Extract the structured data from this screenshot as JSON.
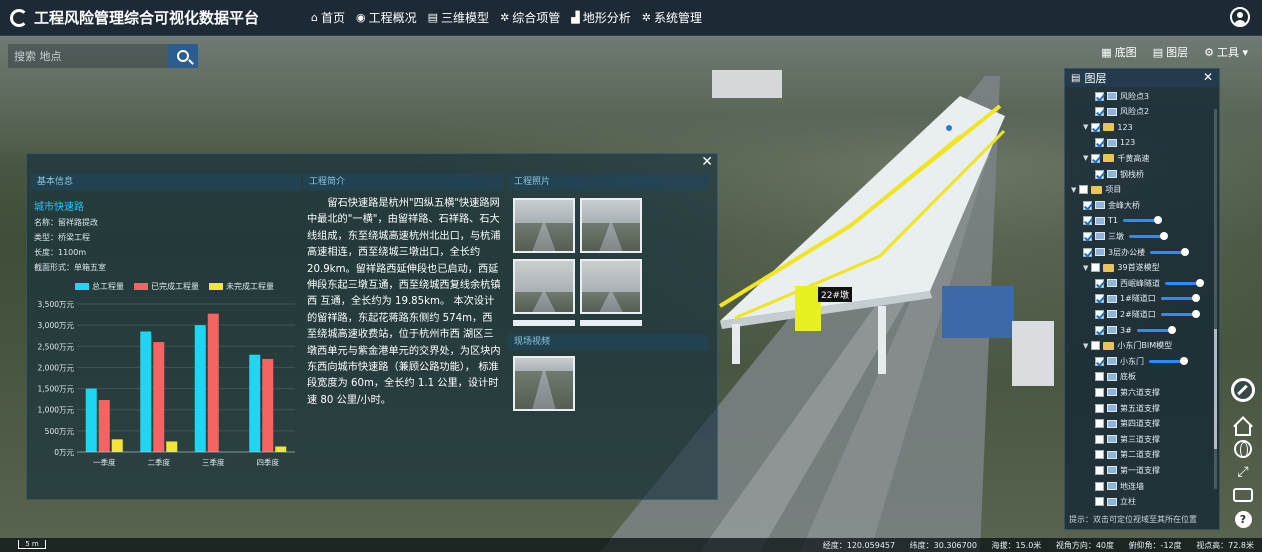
{
  "app": {
    "title": "工程风险管理综合可视化数据平台"
  },
  "nav": [
    {
      "label": "首页",
      "icon": "home-icon"
    },
    {
      "label": "工程概况",
      "icon": "eye-icon"
    },
    {
      "label": "三维模型",
      "icon": "layers-icon"
    },
    {
      "label": "综合项管",
      "icon": "gear-icon"
    },
    {
      "label": "地形分析",
      "icon": "chart-icon"
    },
    {
      "label": "系统管理",
      "icon": "gear-icon"
    }
  ],
  "search": {
    "placeholder": "搜索 地点"
  },
  "toolbar": [
    {
      "label": "底图",
      "icon": "map-icon"
    },
    {
      "label": "图层",
      "icon": "layers-icon"
    },
    {
      "label": "工具 ▾",
      "icon": "tools-icon"
    }
  ],
  "info": {
    "basic": {
      "head": "基本信息",
      "name_link": "城市快速路",
      "name": "名称：留祥路提改",
      "type": "类型：桥梁工程",
      "length": "长度：1100m",
      "section": "截面形式：单箱五室"
    },
    "intro": {
      "head": "工程简介",
      "text": "留石快速路是杭州\"四纵五横\"快速路网中最北的\"一横\"，由留祥路、石祥路、石大线组成，东至绕城高速杭州北出口，与杭浦高速相连，西至绕城三墩出口，全长约 20.9km。留祥路西延伸段也已启动，西延伸段东起三墩互通，西至绕城西复线余杭镇西 互通，全长约为 19.85km。 本次设计的留祥路，东起花蒋路东侧约 574m，西至绕城高速收费站，位于杭州市西 湖区三墩西单元与紫金港单元的交界处，为区块内东西向城市快速路（兼顾公路功能）， 标准段宽度为 60m，全长约 1.1 公里，设计时速 80 公里/小时。"
    },
    "photos": {
      "head": "工程照片"
    },
    "video": {
      "head": "现场视频"
    }
  },
  "chart_data": {
    "type": "bar",
    "categories": [
      "一季度",
      "二季度",
      "三季度",
      "四季度"
    ],
    "series": [
      {
        "name": "总工程量",
        "values": [
          1500,
          2850,
          3000,
          2300
        ],
        "color": "#1fd6f2"
      },
      {
        "name": "已完成工程量",
        "values": [
          1230,
          2600,
          3270,
          2200
        ],
        "color": "#f56363"
      },
      {
        "name": "未完成工程量",
        "values": [
          300,
          250,
          0,
          130
        ],
        "color": "#f4e43a"
      }
    ],
    "yticks": [
      "0万元",
      "500万元",
      "1,000万元",
      "1,500万元",
      "2,000万元",
      "2,500万元",
      "3,000万元",
      "3,500万元"
    ],
    "ylim": [
      0,
      3500
    ],
    "legend_position": "top"
  },
  "layers": {
    "title": "图层",
    "rows": [
      {
        "label": "风险点3",
        "level": 2,
        "kind": "layer",
        "checked": true
      },
      {
        "label": "风险点2",
        "level": 2,
        "kind": "layer",
        "checked": true
      },
      {
        "label": "123",
        "level": 1,
        "kind": "folder",
        "checked": true
      },
      {
        "label": "123",
        "level": 2,
        "kind": "layer",
        "checked": true
      },
      {
        "label": "千黄高速",
        "level": 1,
        "kind": "folder",
        "checked": true
      },
      {
        "label": "钢栈桥",
        "level": 2,
        "kind": "layer",
        "checked": true
      },
      {
        "label": "项目",
        "level": 0,
        "kind": "folder",
        "checked": false
      },
      {
        "label": "金峰大桥",
        "level": 1,
        "kind": "layer",
        "checked": true
      },
      {
        "label": "T1",
        "level": 1,
        "kind": "layer",
        "checked": true,
        "slider": true
      },
      {
        "label": "三墩",
        "level": 1,
        "kind": "layer",
        "checked": true,
        "slider": true
      },
      {
        "label": "3层办公楼",
        "level": 1,
        "kind": "layer",
        "checked": true,
        "slider": true
      },
      {
        "label": "39首遂模型",
        "level": 1,
        "kind": "folder",
        "checked": false
      },
      {
        "label": "西岷峰隧道",
        "level": 2,
        "kind": "layer",
        "checked": true,
        "slider": true
      },
      {
        "label": "1#隧道口",
        "level": 2,
        "kind": "layer",
        "checked": true,
        "slider": true
      },
      {
        "label": "2#隧道口",
        "level": 2,
        "kind": "layer",
        "checked": true,
        "slider": true
      },
      {
        "label": "3#",
        "level": 2,
        "kind": "layer",
        "checked": true,
        "slider": true
      },
      {
        "label": "小东门BIM模型",
        "level": 1,
        "kind": "folder",
        "checked": false
      },
      {
        "label": "小东门",
        "level": 2,
        "kind": "layer",
        "checked": true,
        "slider": true
      },
      {
        "label": "底板",
        "level": 2,
        "kind": "layer",
        "checked": false
      },
      {
        "label": "第六道支撑",
        "level": 2,
        "kind": "layer",
        "checked": false
      },
      {
        "label": "第五道支撑",
        "level": 2,
        "kind": "layer",
        "checked": false
      },
      {
        "label": "第四道支撑",
        "level": 2,
        "kind": "layer",
        "checked": false
      },
      {
        "label": "第三道支撑",
        "level": 2,
        "kind": "layer",
        "checked": false
      },
      {
        "label": "第二道支撑",
        "level": 2,
        "kind": "layer",
        "checked": false
      },
      {
        "label": "第一道支撑",
        "level": 2,
        "kind": "layer",
        "checked": false
      },
      {
        "label": "地连墙",
        "level": 2,
        "kind": "layer",
        "checked": false
      },
      {
        "label": "立柱",
        "level": 2,
        "kind": "layer",
        "checked": false
      }
    ],
    "hint": "提示：双击可定位视域至其所在位置"
  },
  "model_tag": "22#墩",
  "status": {
    "scale": "5 m",
    "lon": "经度：120.059457",
    "lat": "纬度：30.306700",
    "alt": "海拔：15.0米",
    "heading": "视角方向：40度",
    "pitch": "俯仰角：-12度",
    "height": "视点高：72.8米"
  }
}
